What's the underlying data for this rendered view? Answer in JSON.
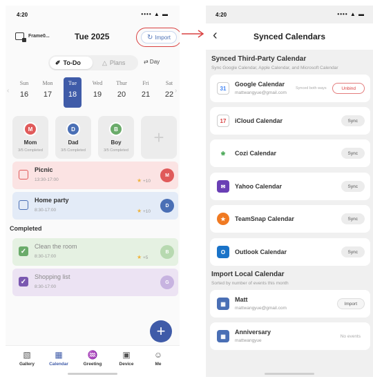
{
  "left": {
    "status_time": "4:20",
    "status_icons": "•••• ▲ ▬",
    "frame_name": "Frame0...",
    "date_title": "Tue 2025",
    "import_label": "Import",
    "import_icon": "↻",
    "segments": {
      "todo": "To-Do",
      "plans": "Plans",
      "todo_icon": "✐",
      "plans_icon": "△"
    },
    "day_toggle": "⇄ Day",
    "week": [
      {
        "name": "Sun",
        "day": "16"
      },
      {
        "name": "Mon",
        "day": "17"
      },
      {
        "name": "Tue",
        "day": "18",
        "selected": true
      },
      {
        "name": "Wed",
        "day": "19"
      },
      {
        "name": "Thur",
        "day": "20"
      },
      {
        "name": "Fri",
        "day": "21"
      },
      {
        "name": "Sat",
        "day": "22"
      }
    ],
    "members": [
      {
        "initial": "M",
        "name": "Mom",
        "status": "3/5 Completed",
        "color": "#e05a5a"
      },
      {
        "initial": "D",
        "name": "Dad",
        "status": "3/5 Completed",
        "color": "#4a6fb5"
      },
      {
        "initial": "B",
        "name": "Boy",
        "status": "3/5 Completed",
        "color": "#6aab6a"
      }
    ],
    "add_member": "+",
    "tasks": [
      {
        "title": "Picnic",
        "time": "13:30-17:00",
        "points": "+10",
        "avatar": "M"
      },
      {
        "title": "Home party",
        "time": "8:30-17:00",
        "points": "+10",
        "avatar": "D"
      }
    ],
    "completed_header": "Completed",
    "completed_tasks": [
      {
        "title": "Clean the room",
        "time": "8:30-17:00",
        "points": "+5",
        "avatar": "B"
      },
      {
        "title": "Shopping list",
        "time": "8:30-17:00",
        "avatar": "G"
      }
    ],
    "fab": "+",
    "tabs": [
      {
        "icon": "▧",
        "label": "Gallery"
      },
      {
        "icon": "▦",
        "label": "Calendar",
        "active": true
      },
      {
        "icon": "♒",
        "label": "Greeting"
      },
      {
        "icon": "▣",
        "label": "Device"
      },
      {
        "icon": "☺",
        "label": "Me"
      }
    ],
    "colors": {
      "primary": "#3f5ba8",
      "red": "#e05a5a",
      "green": "#6aab6a",
      "purple": "#7a58b0"
    }
  },
  "right": {
    "status_time": "4:20",
    "status_icons": "•••• ▲ ▬",
    "back": "‹",
    "title": "Synced Calendars",
    "third_party_title": "Synced Third-Party Calendar",
    "third_party_sub": "Sync Google Calendar, Apple Calendar, and Microsoft Calendar",
    "google": {
      "name": "Google Calendar",
      "email": "mattwangyue@gmail.com",
      "status": "Synced both ways",
      "action": "Unbind",
      "icon": "31"
    },
    "icloud": {
      "name": "iCloud Calendar",
      "action": "Sync",
      "icon": "17"
    },
    "cozi": {
      "name": "Cozi Calendar",
      "action": "Sync",
      "icon": "❀"
    },
    "yahoo": {
      "name": "Yahoo Calendar",
      "action": "Sync",
      "icon": "✉"
    },
    "teamsnap": {
      "name": "TeamSnap Calendar",
      "action": "Sync",
      "icon": "★"
    },
    "outlook": {
      "name": "Outlook  Calendar",
      "action": "Sync",
      "icon": "O"
    },
    "local_title": "Import Local Calendar",
    "local_sub": "Sorted by number of events this month",
    "local": [
      {
        "name": "Matt",
        "email": "mattwangyue@gmail.com",
        "action": "Import",
        "icon": "▦"
      },
      {
        "name": "Anniversary",
        "email": "mattwangyue",
        "action": "No events",
        "icon": "▦"
      }
    ]
  }
}
